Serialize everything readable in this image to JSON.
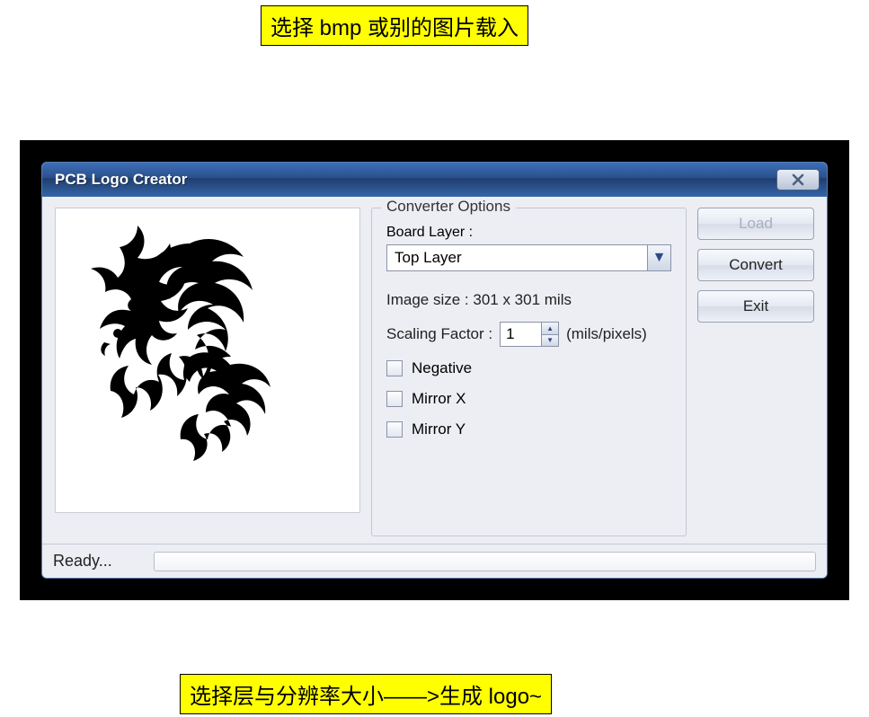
{
  "annotations": {
    "top": "选择 bmp 或别的图片载入",
    "bottom": "选择层与分辨率大小——>生成 logo~"
  },
  "window": {
    "title": "PCB Logo Creator"
  },
  "options": {
    "legend": "Converter Options",
    "board_layer_label": "Board Layer :",
    "board_layer_value": "Top Layer",
    "image_size_text": "Image size : 301 x 301 mils",
    "scaling_label": "Scaling Factor :",
    "scaling_value": "1",
    "scaling_unit": "(mils/pixels)",
    "negative_label": "Negative",
    "mirrorx_label": "Mirror X",
    "mirrory_label": "Mirror Y"
  },
  "buttons": {
    "load": "Load",
    "convert": "Convert",
    "exit": "Exit"
  },
  "status": {
    "text": "Ready..."
  }
}
